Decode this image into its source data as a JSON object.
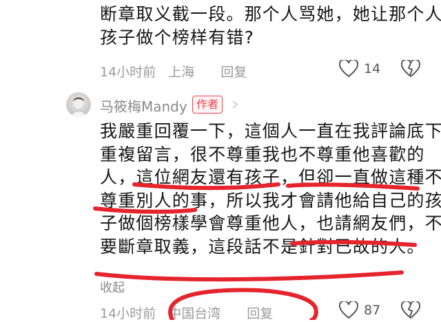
{
  "previous_comment": {
    "text_lines": [
      "断章取义截一段。那个人骂她，她让那个人",
      "孩子做个榜样有错?"
    ],
    "time": "14小时前",
    "location": "上海",
    "reply_label": "回复",
    "like_count": "14"
  },
  "author_comment": {
    "username": "马筱梅Mandy",
    "badge": "作者",
    "text_lines": [
      "我嚴重回覆一下，這個人一直在我評論底下",
      "重複留言，很不尊重我也不尊重他喜歡的",
      "人，這位網友還有孩子，但卻一直做這種不",
      "尊重別人的事，所以我才會請他給自己的孩",
      "子做個榜樣學會尊重他人，也請網友們，不",
      "要斷章取義，這段話不是針對已故的人。"
    ],
    "collapse_label": "收起",
    "time": "14小时前",
    "location": "中国台湾",
    "reply_label": "回复",
    "like_count": "87"
  },
  "annotation_color": "#e5242b"
}
